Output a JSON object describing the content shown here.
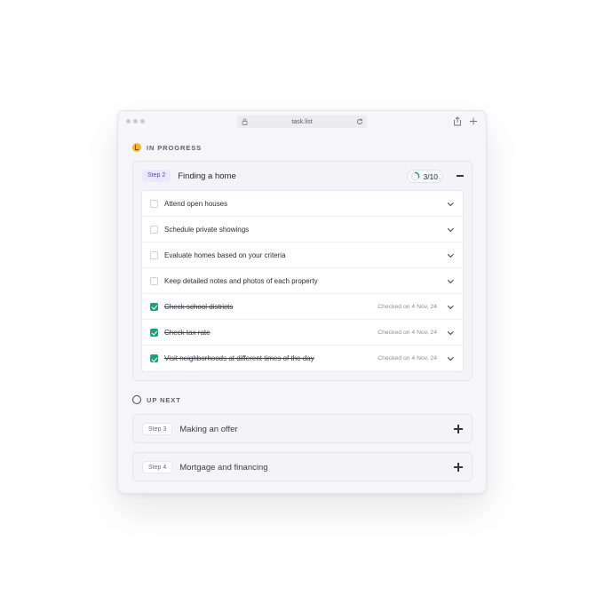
{
  "browser": {
    "url": "task.list"
  },
  "in_progress": {
    "heading": "IN PROGRESS",
    "step_badge": "Step 2",
    "title": "Finding a home",
    "progress_text": "3/10",
    "progress_fraction": 0.3,
    "tasks": [
      {
        "label": "Attend open houses",
        "checked": false,
        "checked_on": ""
      },
      {
        "label": "Schedule private showings",
        "checked": false,
        "checked_on": ""
      },
      {
        "label": "Evaluate homes based on your criteria",
        "checked": false,
        "checked_on": ""
      },
      {
        "label": "Keep detailed notes and photos of each property",
        "checked": false,
        "checked_on": ""
      },
      {
        "label": "Check school districts",
        "checked": true,
        "checked_on": "Checked on 4 Nov, 24"
      },
      {
        "label": "Check tax rate",
        "checked": true,
        "checked_on": "Checked on 4 Nov, 24"
      },
      {
        "label": "Visit neighborhoods at different times of the day",
        "checked": true,
        "checked_on": "Checked on 4 Nov, 24"
      }
    ]
  },
  "up_next": {
    "heading": "UP NEXT",
    "items": [
      {
        "step_badge": "Step 3",
        "title": "Making an offer"
      },
      {
        "step_badge": "Step 4",
        "title": "Mortgage and financing"
      }
    ]
  },
  "colors": {
    "accent_purple": "#5b3fd6",
    "check_green": "#18a37f",
    "in_progress_yellow": "#f3b81b",
    "progress_ring": "#18a37f"
  },
  "icons": [
    "lock-icon",
    "reload-icon",
    "share-icon",
    "plus-icon",
    "in-progress-icon",
    "up-next-icon",
    "chevron-down-icon",
    "collapse-icon"
  ]
}
